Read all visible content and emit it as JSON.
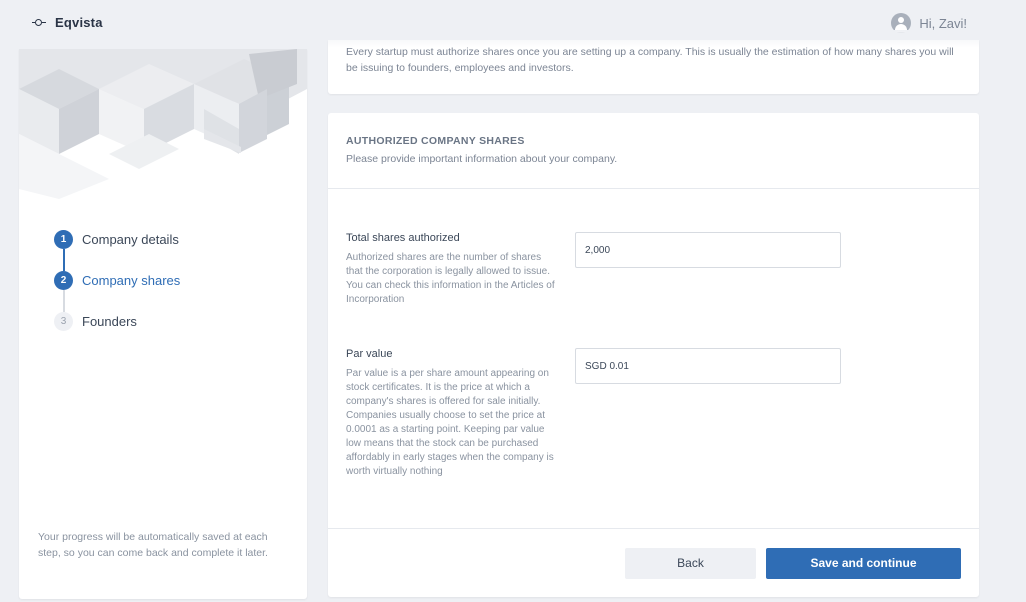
{
  "header": {
    "brand": "Eqvista",
    "greeting": "Hi, Zavi!"
  },
  "sidebar": {
    "steps": [
      {
        "number": "1",
        "label": "Company details",
        "state": "done"
      },
      {
        "number": "2",
        "label": "Company shares",
        "state": "current"
      },
      {
        "number": "3",
        "label": "Founders",
        "state": "todo"
      }
    ],
    "progress_note": "Your progress will be automatically saved at each step, so you can come back and complete it later."
  },
  "intro": {
    "text": "Every startup must authorize shares once you are setting up a company. This is usually the estimation of how many shares you will be issuing to founders, employees and investors."
  },
  "form": {
    "section_title": "AUTHORIZED COMPANY SHARES",
    "section_subtitle": "Please provide important information about your company.",
    "fields": [
      {
        "label": "Total shares authorized",
        "description": "Authorized shares are the number of shares that the corporation is legally allowed to issue. You can check this information in the Articles of Incorporation",
        "value": "2,000"
      },
      {
        "label": "Par value",
        "description": "Par value is a per share amount appearing on stock certificates. It is the price at which a company's shares is offered for sale initially. Companies usually choose to set the price at 0.0001 as a starting point. Keeping par value low means that the stock can be purchased affordably in early stages when the company is worth virtually nothing",
        "value": "SGD 0.01"
      }
    ],
    "back_label": "Back",
    "save_label": "Save and continue"
  },
  "colors": {
    "accent": "#2f6db5",
    "background": "#eef0f4",
    "card": "#ffffff"
  },
  "icons": {
    "logo": "eqvista-logo-icon",
    "user": "user-avatar-icon"
  }
}
